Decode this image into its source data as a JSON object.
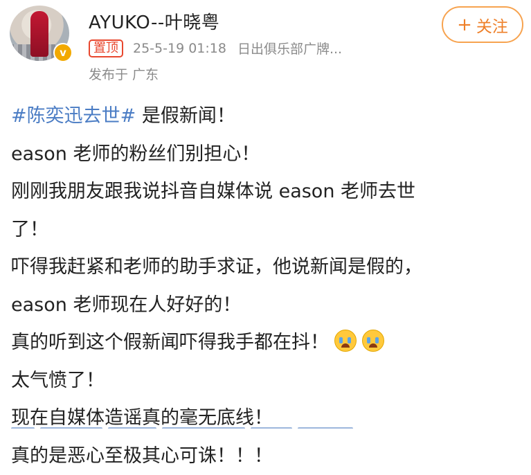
{
  "post": {
    "author": {
      "name": "AYUKO--叶晓粤",
      "avatar_icon": "user-avatar",
      "verified_icon": "verified-badge-icon",
      "verified_mark": "v"
    },
    "follow_button": {
      "plus": "+",
      "label": "关注"
    },
    "pinned_label": "置顶",
    "timestamp": "25-5-19 01:18",
    "source": "日出俱乐部广牌...",
    "location": "发布于 广东",
    "content": {
      "hashtag": "#陈奕迅去世#",
      "line1_rest": " 是假新闻！",
      "lines": [
        "eason 老师的粉丝们别担心！",
        "刚刚我朋友跟我说抖音自媒体说 eason 老师去世",
        "了！",
        "吓得我赶紧和老师的助手求证，他说新闻是假的，",
        "eason 老师现在人好好的！",
        "真的听到这个假新闻吓得我手都在抖！",
        "太气愤了！",
        "现在自媒体造谣真的毫无底线！",
        "真的是恶心至极其心可诛！！！"
      ],
      "emoji_names": [
        "crying-face-icon",
        "crying-face-icon"
      ]
    }
  },
  "colors": {
    "hashtag": "#4a7cc4",
    "follow": "#ee7f28",
    "pinned": "#e8472e",
    "meta_text": "#8a8a8a",
    "verified": "#f2a900"
  }
}
